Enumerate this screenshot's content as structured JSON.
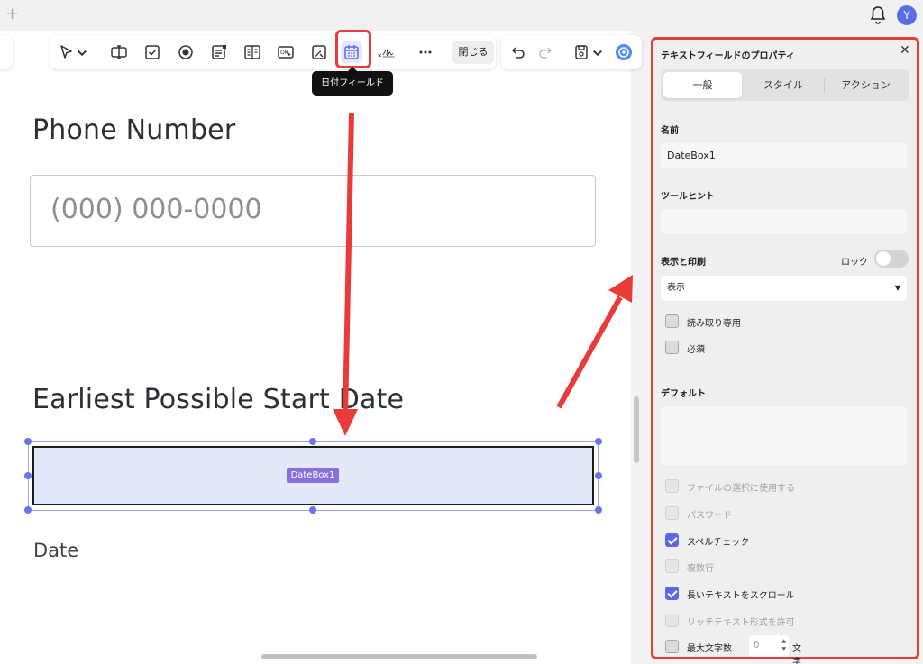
{
  "toolbar": {
    "close_label": "閉じる",
    "tooltip": "日付フィールド"
  },
  "user": {
    "avatar_initial": "Y"
  },
  "form": {
    "phone_label": "Phone Number",
    "phone_placeholder": "(000) 000-0000",
    "start_date_label": "Earliest Possible Start Date",
    "datebox_name": "DateBox1",
    "date_label": "Date"
  },
  "panel": {
    "title": "テキストフィールドのプロパティ",
    "tabs": [
      "一般",
      "スタイル",
      "アクション"
    ],
    "name_label": "名前",
    "name_value": "DateBox1",
    "tooltip_label": "ツールヒント",
    "tooltip_value": "",
    "visibility_label": "表示と印刷",
    "lock_label": "ロック",
    "visibility_value": "表示",
    "readonly_label": "読み取り専用",
    "required_label": "必須",
    "default_label": "デフォルト",
    "default_value": "",
    "options": [
      {
        "label": "ファイルの選択に使用する",
        "checked": false,
        "disabled": true
      },
      {
        "label": "パスワード",
        "checked": false,
        "disabled": true
      },
      {
        "label": "スペルチェック",
        "checked": true,
        "disabled": false
      },
      {
        "label": "複数行",
        "checked": false,
        "disabled": true
      },
      {
        "label": "長いテキストをスクロール",
        "checked": true,
        "disabled": false
      },
      {
        "label": "リッチテキスト形式を許可",
        "checked": false,
        "disabled": true
      }
    ],
    "max_chars_label": "最大文字数",
    "max_chars_value": "0",
    "max_chars_suffix": "文字"
  },
  "colors": {
    "accent": "#5b68e6",
    "annotation": "#ea3b3b",
    "field_fill": "#e4e9f9"
  }
}
